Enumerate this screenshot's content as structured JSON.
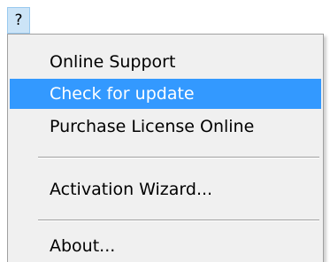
{
  "menu": {
    "title": "?",
    "items": [
      {
        "label": "Online Support"
      },
      {
        "label": "Check for update",
        "highlighted": true
      },
      {
        "label": "Purchase License Online"
      },
      {
        "label": "Activation Wizard..."
      },
      {
        "label": "About..."
      }
    ]
  },
  "colors": {
    "highlight": "#3399ff",
    "menu_background": "#f0f0f0",
    "title_highlight": "#cce4f7"
  }
}
